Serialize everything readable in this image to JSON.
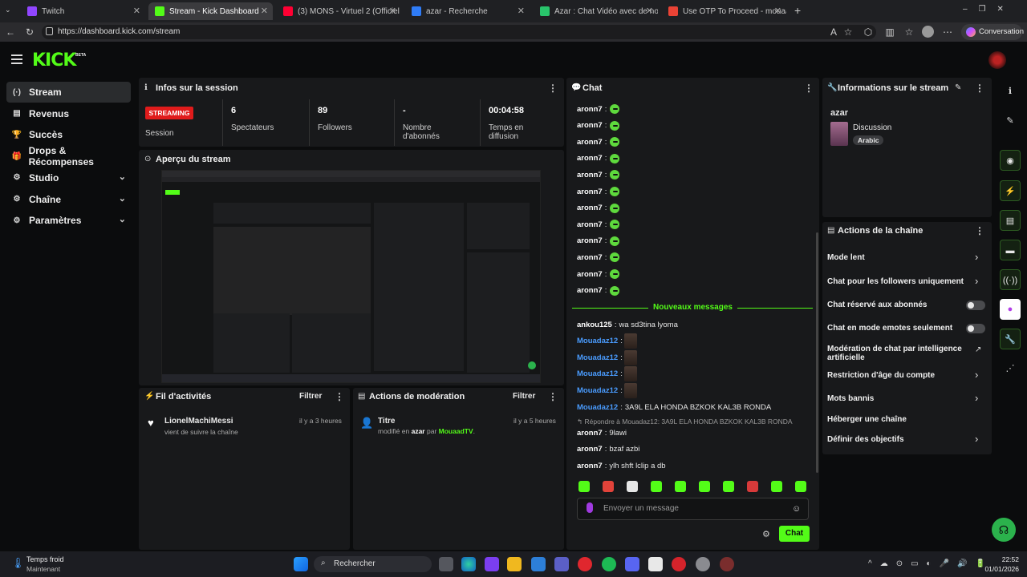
{
  "browser": {
    "tabs": [
      {
        "label": "Twitch",
        "color": "#9146ff"
      },
      {
        "label": "Stream - Kick Dashboard",
        "color": "#53fc18",
        "active": true
      },
      {
        "label": "(3) MONS - Virtuel 2 (Officiel",
        "color": "#ff0033"
      },
      {
        "label": "azar - Recherche",
        "color": "#2f7cf6"
      },
      {
        "label": "Azar : Chat Vidéo avec de nou",
        "color": "#29c46b"
      },
      {
        "label": "Use OTP To Proceed - mouaadism",
        "color": "#ea4335"
      }
    ],
    "url": "https://dashboard.kick.com/stream",
    "conversation_label": "Conversation"
  },
  "app": {
    "logo": "KICK",
    "beta": "BETA"
  },
  "sidebar": {
    "items": [
      {
        "label": "Stream",
        "icon": "(·)",
        "active": true
      },
      {
        "label": "Revenus",
        "icon": "▤"
      },
      {
        "label": "Succès",
        "icon": "🏆"
      },
      {
        "label": "Drops & Récompenses",
        "icon": "🎁"
      },
      {
        "label": "Studio",
        "icon": "⚙",
        "chevron": true
      },
      {
        "label": "Chaîne",
        "icon": "⚙",
        "chevron": true
      },
      {
        "label": "Paramètres",
        "icon": "⚙",
        "chevron": true
      }
    ]
  },
  "session": {
    "title": "Infos sur la session",
    "badge": "STREAMING",
    "badge_label": "Session",
    "stats": [
      {
        "value": "6",
        "label": "Spectateurs"
      },
      {
        "value": "89",
        "label": "Followers"
      },
      {
        "value": "-",
        "label": "Nombre d'abonnés"
      },
      {
        "value": "00:04:58",
        "label": "Temps en diffusion"
      }
    ]
  },
  "preview": {
    "title": "Aperçu du stream"
  },
  "activity": {
    "title": "Fil d'activités",
    "filter": "Filtrer",
    "items": [
      {
        "user": "LionelMachiMessi",
        "text": "vient de suivre la chaîne",
        "time": "il y a 3 heures"
      }
    ]
  },
  "moderation": {
    "title": "Actions de modération",
    "filter": "Filtrer",
    "items": [
      {
        "title": "Titre",
        "pre": "modifié en",
        "target": "azar",
        "mid": "par",
        "by": "MouaadTV",
        "end": ".",
        "time": "il y a 5 heures"
      }
    ]
  },
  "chat": {
    "title": "Chat",
    "new_messages": "Nouveaux messages",
    "messages": [
      {
        "user": "aronn7",
        "color": "#fff",
        "kind": "emote"
      },
      {
        "user": "aronn7",
        "color": "#fff",
        "kind": "emote"
      },
      {
        "user": "aronn7",
        "color": "#fff",
        "kind": "emote"
      },
      {
        "user": "aronn7",
        "color": "#fff",
        "kind": "emote"
      },
      {
        "user": "aronn7",
        "color": "#fff",
        "kind": "emote"
      },
      {
        "user": "aronn7",
        "color": "#fff",
        "kind": "emote"
      },
      {
        "user": "aronn7",
        "color": "#fff",
        "kind": "emote"
      },
      {
        "user": "aronn7",
        "color": "#fff",
        "kind": "emote"
      },
      {
        "user": "aronn7",
        "color": "#fff",
        "kind": "emote"
      },
      {
        "user": "aronn7",
        "color": "#fff",
        "kind": "emote"
      },
      {
        "user": "aronn7",
        "color": "#fff",
        "kind": "emote"
      },
      {
        "user": "aronn7",
        "color": "#fff",
        "kind": "emote"
      }
    ],
    "new": [
      {
        "user": "ankou125",
        "color": "#fff",
        "text": "wa sd3tina lyoma"
      },
      {
        "user": "Mouadaz12",
        "color": "#4a9cff",
        "kind": "face"
      },
      {
        "user": "Mouadaz12",
        "color": "#4a9cff",
        "kind": "face"
      },
      {
        "user": "Mouadaz12",
        "color": "#4a9cff",
        "kind": "face"
      },
      {
        "user": "Mouadaz12",
        "color": "#4a9cff",
        "kind": "face"
      },
      {
        "user": "Mouadaz12",
        "color": "#4a9cff",
        "text": "3A9L ELA HONDA BZKOK KAL3B RONDA"
      }
    ],
    "reply_to": "Répondre à Mouadaz12: 3A9L ELA HONDA BZKOK KAL3B RONDA",
    "after": [
      {
        "user": "aronn7",
        "color": "#fff",
        "text": "9lawi"
      },
      {
        "user": "aronn7",
        "color": "#fff",
        "text": "bzaf azbi"
      },
      {
        "user": "aronn7",
        "color": "#fff",
        "text": "ylh shft lclip a db"
      }
    ],
    "placeholder": "Envoyer un message",
    "send": "Chat"
  },
  "stream_info": {
    "title": "Informations sur le stream",
    "stream_title": "azar",
    "category": "Discussion",
    "language": "Arabic"
  },
  "channel_actions": {
    "title": "Actions de la chaîne",
    "items": [
      {
        "label": "Mode lent",
        "type": "arrow"
      },
      {
        "label": "Chat pour les followers uniquement",
        "type": "arrow"
      },
      {
        "label": "Chat réservé aux abonnés",
        "type": "toggle"
      },
      {
        "label": "Chat en mode emotes seulement",
        "type": "toggle"
      },
      {
        "label": "Modération de chat par intelligence artificielle",
        "type": "external"
      },
      {
        "label": "Restriction d'âge du compte",
        "type": "arrow"
      },
      {
        "label": "Mots bannis",
        "type": "arrow"
      },
      {
        "label": "Héberger une chaîne",
        "type": "none"
      },
      {
        "label": "Définir des objectifs",
        "type": "arrow"
      }
    ]
  },
  "taskbar": {
    "weather": "Temps froid",
    "weather_sub": "Maintenant",
    "search": "Rechercher",
    "time": "22:52",
    "date": "01/01/2026"
  }
}
